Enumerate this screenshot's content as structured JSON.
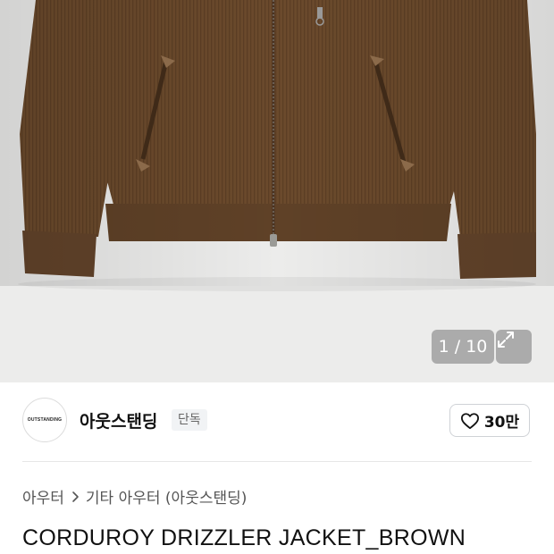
{
  "gallery": {
    "image_alt": "corduroy-jacket-photo",
    "current_index": "1",
    "total": "10",
    "counter_text": "1 / 10",
    "expand_icon": "expand-icon",
    "background_color": "#ececeb",
    "jacket_color": "#6b4a2c"
  },
  "brand": {
    "logo_text": "OUTSTANDING",
    "name": "아웃스탠딩",
    "badge": "단독",
    "like_icon": "heart-icon",
    "like_count": "30만"
  },
  "breadcrumb": {
    "items": [
      "아우터",
      "기타 아우터 (아웃스탠딩)"
    ],
    "separator_icon": "chevron-right-icon"
  },
  "product": {
    "title": "CORDUROY DRIZZLER JACKET_BROWN"
  }
}
